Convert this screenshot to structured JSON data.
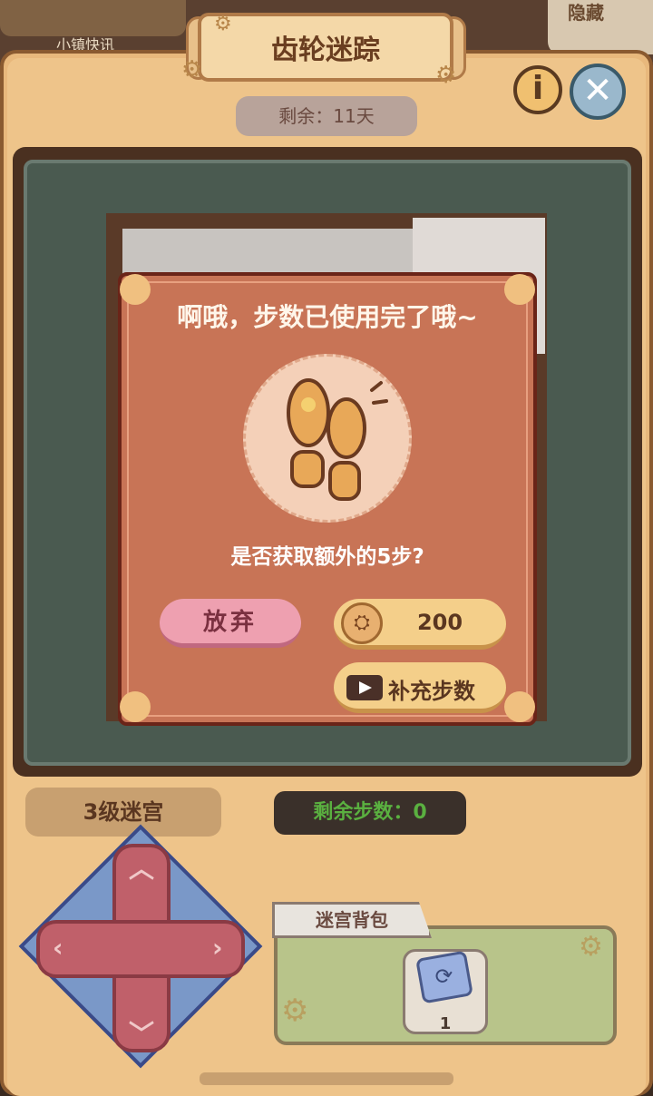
{
  "top": {
    "prev_label": "小镇快讯",
    "hide_label": "隐藏"
  },
  "header": {
    "title": "齿轮迷踪",
    "remaining_days": "剩余：11天",
    "info_icon": "info-icon",
    "close_icon": "close-icon"
  },
  "dialog": {
    "title": "啊哦，步数已使用完了哦~",
    "question": "是否获取额外的5步?",
    "giveup_label": "放弃",
    "coin_value": "200",
    "video_label": "补充步数"
  },
  "footer": {
    "level_label": "3级迷宫",
    "steps_label": "剩余步数：0",
    "bag_label": "迷宫背包",
    "bag_items": [
      {
        "icon": "refresh-card-icon",
        "count": "1"
      }
    ]
  },
  "colors": {
    "dialog_bg": "#c87456",
    "accent_green": "#5ab040",
    "panel": "#e8b87c"
  }
}
